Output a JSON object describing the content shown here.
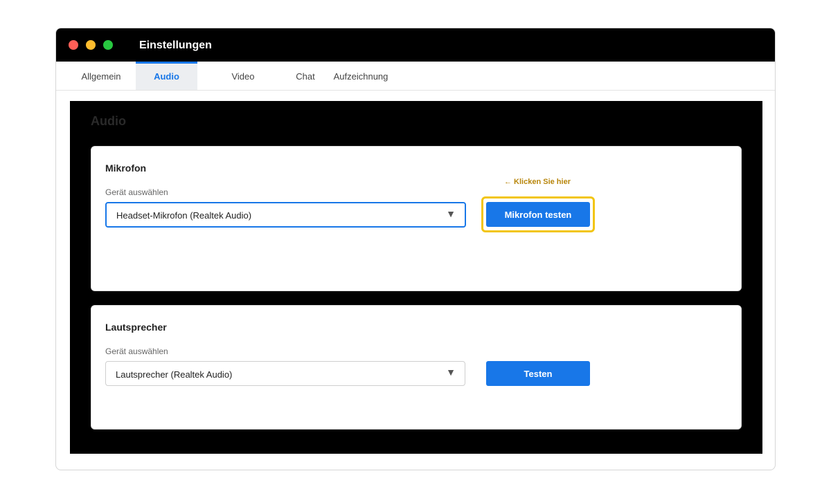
{
  "window": {
    "title": "Einstellungen",
    "controls": {
      "close_color": "#ff5f57",
      "minimize_color": "#febc2e",
      "zoom_color": "#28c840"
    }
  },
  "tabs": [
    {
      "label": "Allgemein",
      "active": false
    },
    {
      "label": "Audio",
      "active": true
    },
    {
      "label": "Video",
      "active": false
    },
    {
      "label": "Chat",
      "active": false
    },
    {
      "label": "Aufzeichnung",
      "active": false
    }
  ],
  "section": {
    "title": "Audio"
  },
  "microphone": {
    "title": "Mikrofon",
    "device_label": "Gerät auswählen",
    "device_value": "Headset-Mikrofon (Realtek Audio)",
    "test_button": "Mikrofon testen",
    "hint": "← Klicken Sie hier"
  },
  "speaker": {
    "title": "Lautsprecher",
    "device_label": "Gerät auswählen",
    "device_value": "Lautsprecher (Realtek Audio)",
    "test_button": "Testen"
  },
  "icons": {
    "dropdown": "▼"
  },
  "colors": {
    "accent": "#1877e8",
    "highlight": "#f2c511",
    "hint": "#b8860b"
  }
}
